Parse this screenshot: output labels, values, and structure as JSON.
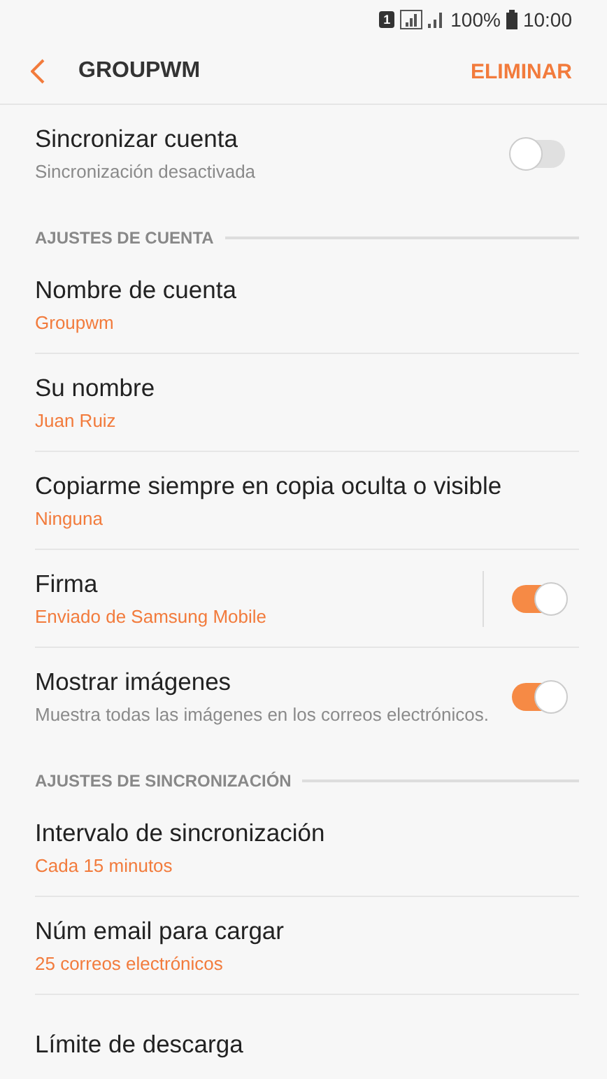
{
  "status_bar": {
    "sim": "1",
    "battery": "100%",
    "time": "10:00"
  },
  "header": {
    "title": "GROUPWM",
    "action": "ELIMINAR"
  },
  "sections": [
    {
      "items": [
        {
          "kind": "switch",
          "title": "Sincronizar cuenta",
          "subtitle": "Sincronización desactivada",
          "on": false
        }
      ]
    },
    {
      "heading": "AJUSTES DE CUENTA",
      "items": [
        {
          "kind": "value",
          "title": "Nombre de cuenta",
          "subtitle": "Groupwm"
        },
        {
          "kind": "value",
          "title": "Su nombre",
          "subtitle": "Juan Ruiz"
        },
        {
          "kind": "value",
          "title": "Copiarme siempre en copia oculta o visible",
          "subtitle": "Ninguna"
        },
        {
          "kind": "value_switch",
          "title": "Firma",
          "subtitle": "Enviado de Samsung Mobile",
          "on": true
        },
        {
          "kind": "switch",
          "title": "Mostrar imágenes",
          "subtitle": "Muestra todas las imágenes en los correos electrónicos.",
          "on": true
        }
      ]
    },
    {
      "heading": "AJUSTES DE SINCRONIZACIÓN",
      "items": [
        {
          "kind": "value",
          "title": "Intervalo de sincronización",
          "subtitle": "Cada 15 minutos"
        },
        {
          "kind": "value",
          "title": "Núm email para cargar",
          "subtitle": "25 correos electrónicos"
        },
        {
          "kind": "value",
          "title": "Límite de descarga"
        }
      ]
    }
  ]
}
